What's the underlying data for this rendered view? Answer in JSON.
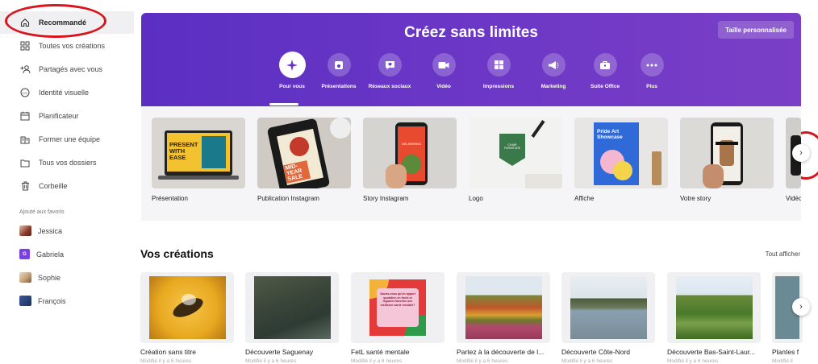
{
  "sidebar": {
    "items": [
      {
        "label": "Recommandé",
        "icon": "home-icon"
      },
      {
        "label": "Toutes vos créations",
        "icon": "grid-icon"
      },
      {
        "label": "Partagés avec vous",
        "icon": "shared-users-icon"
      },
      {
        "label": "Identité visuelle",
        "icon": "brand-kit-icon"
      },
      {
        "label": "Planificateur",
        "icon": "calendar-icon"
      },
      {
        "label": "Former une équipe",
        "icon": "team-icon"
      },
      {
        "label": "Tous vos dossiers",
        "icon": "folder-icon"
      },
      {
        "label": "Corbeille",
        "icon": "trash-icon"
      }
    ],
    "favorites_header": "Ajouté aux favoris",
    "favorites": [
      {
        "label": "Jessica",
        "color": "#8a3a2a"
      },
      {
        "label": "Gabriela",
        "initial": "G",
        "color": "#7b3fe4"
      },
      {
        "label": "Sophie",
        "color": "#c9a880"
      },
      {
        "label": "François",
        "color": "#1e2f5a"
      }
    ]
  },
  "hero": {
    "title": "Créez sans limites",
    "custom_size_button": "Taille personnalisée",
    "categories": [
      {
        "label": "Pour vous",
        "icon": "sparkle-icon"
      },
      {
        "label": "Présentations",
        "icon": "presentation-icon"
      },
      {
        "label": "Réseaux sociaux",
        "icon": "heart-chat-icon"
      },
      {
        "label": "Vidéo",
        "icon": "video-camera-icon"
      },
      {
        "label": "Impressions",
        "icon": "print-icon"
      },
      {
        "label": "Marketing",
        "icon": "megaphone-icon"
      },
      {
        "label": "Suite Office",
        "icon": "briefcase-icon"
      },
      {
        "label": "Plus",
        "icon": "more-dots-icon"
      }
    ]
  },
  "templates": [
    {
      "label": "Présentation",
      "thumb_text": "PRESENT WITH EASE"
    },
    {
      "label": "Publication Instagram",
      "thumb_text": "MID-YEAR SALE"
    },
    {
      "label": "Story Instagram",
      "thumb_text": "DELIVERING"
    },
    {
      "label": "Logo",
      "thumb_text": "CHAIR FURNITURE"
    },
    {
      "label": "Affiche",
      "thumb_text": "Pride Art Showcase"
    },
    {
      "label": "Votre story",
      "thumb_text": ""
    },
    {
      "label": "Vidéo"
    }
  ],
  "designs_section": {
    "title": "Vos créations",
    "see_all": "Tout afficher",
    "items": [
      {
        "title": "Création sans titre",
        "meta": "Modifié il y a 6 heures"
      },
      {
        "title": "Découverte Saguenay",
        "meta": "Modifié il y a 6 heures"
      },
      {
        "title": "FetL santé mentale",
        "meta": "Modifié il y a 6 heures",
        "thumb_text": "Saviez-vous qu'un apport quotidien en fruits et légumes favorise une meilleure santé mentale?"
      },
      {
        "title": "Partez à la découverte de l...",
        "meta": "Modifié il y a 6 heures"
      },
      {
        "title": "Découverte Côte-Nord",
        "meta": "Modifié il y a 6 heures"
      },
      {
        "title": "Découverte Bas-Saint-Laur...",
        "meta": "Modifié il y a 6 heures"
      },
      {
        "title": "Plantes f",
        "meta": "Modifié il"
      }
    ]
  },
  "colors": {
    "hero_purple": "#5b2fc2",
    "annotation_red": "#d8141c"
  }
}
